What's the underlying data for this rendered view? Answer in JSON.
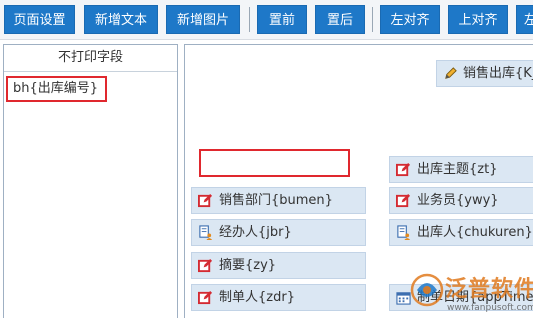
{
  "toolbar": {
    "buttons": [
      {
        "label": "页面设置"
      },
      {
        "label": "新增文本"
      },
      {
        "label": "新增图片"
      },
      {
        "label": "置前"
      },
      {
        "label": "置后"
      },
      {
        "label": "左对齐"
      },
      {
        "label": "上对齐"
      },
      {
        "label": "左"
      }
    ]
  },
  "left_panel": {
    "title": "不打印字段",
    "items": [
      {
        "label": "bh{出库编号}"
      }
    ]
  },
  "canvas": {
    "fields": [
      {
        "label": "销售出库{K_",
        "icon": "pencil-icon"
      },
      {
        "label": "出库主题{zt}",
        "icon": "edit-icon"
      },
      {
        "label": "销售部门{bumen}",
        "icon": "edit-icon"
      },
      {
        "label": "业务员{ywy}",
        "icon": "edit-icon"
      },
      {
        "label": "经办人{jbr}",
        "icon": "document-user-icon"
      },
      {
        "label": "出库人{chukuren}",
        "icon": "document-user-icon"
      },
      {
        "label": "摘要{zy}",
        "icon": "edit-icon"
      },
      {
        "label": "制单人{zdr}",
        "icon": "edit-icon"
      },
      {
        "label": "制单日期{appTime}",
        "icon": "calendar-icon"
      }
    ]
  },
  "watermark": {
    "brand": "泛普软件",
    "url": "www.fanpusoft.com"
  },
  "colors": {
    "accent": "#1e78c8",
    "highlight_border": "#e0282e",
    "field_background": "#dbe7f3"
  }
}
